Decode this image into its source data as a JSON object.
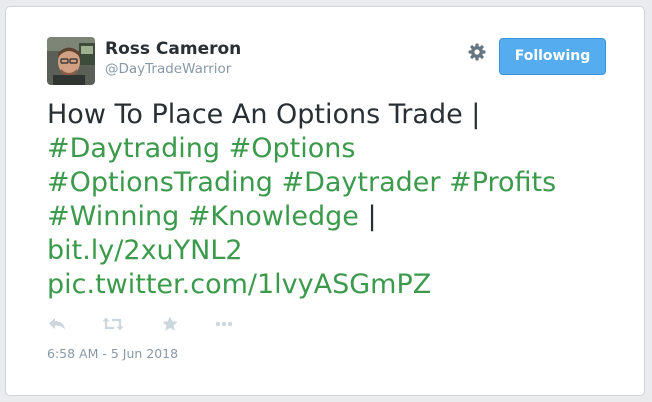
{
  "author": {
    "name": "Ross Cameron",
    "handle": "@DayTradeWarrior"
  },
  "header": {
    "follow_button_label": "Following",
    "settings_icon": "gear-icon"
  },
  "tweet": {
    "lines": [
      [
        {
          "text": "How To Place An Options Trade |",
          "type": "text"
        }
      ],
      [
        {
          "text": "#Daytrading",
          "type": "hashtag"
        },
        {
          "text": " ",
          "type": "text"
        },
        {
          "text": "#Options",
          "type": "hashtag"
        }
      ],
      [
        {
          "text": "#OptionsTrading",
          "type": "hashtag"
        },
        {
          "text": " ",
          "type": "text"
        },
        {
          "text": "#Daytrader",
          "type": "hashtag"
        },
        {
          "text": " ",
          "type": "text"
        },
        {
          "text": "#Profits",
          "type": "hashtag"
        }
      ],
      [
        {
          "text": "#Winning",
          "type": "hashtag"
        },
        {
          "text": " ",
          "type": "text"
        },
        {
          "text": "#Knowledge",
          "type": "hashtag"
        },
        {
          "text": " |",
          "type": "text"
        }
      ],
      [
        {
          "text": "bit.ly/2xuYNL2",
          "type": "url"
        }
      ],
      [
        {
          "text": "pic.twitter.com/1lvyASGmPZ",
          "type": "url"
        }
      ]
    ]
  },
  "actions": {
    "items": [
      "reply-icon",
      "retweet-icon",
      "like-star-icon",
      "more-dots-icon"
    ]
  },
  "timestamp": "6:58 AM - 5 Jun 2018",
  "colors": {
    "link": "#3b9a4b",
    "follow_button": "#55acee",
    "text": "#292f33",
    "muted": "#8899a6",
    "icon": "#ccd6dd"
  }
}
